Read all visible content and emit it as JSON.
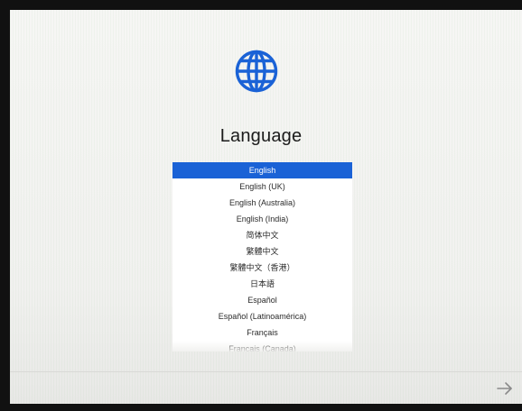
{
  "setup": {
    "title": "Language",
    "icons": {
      "globe": "globe-icon",
      "continue": "right-arrow-icon"
    },
    "colors": {
      "accent": "#1a62d6",
      "globe": "#1a62d6",
      "background": "#f4f4f2"
    },
    "languages": [
      "English",
      "English (UK)",
      "English (Australia)",
      "English (India)",
      "简体中文",
      "繁體中文",
      "繁體中文（香港）",
      "日本語",
      "Español",
      "Español (Latinoamérica)",
      "Français",
      "Français (Canada)"
    ],
    "selected_language": "English"
  }
}
